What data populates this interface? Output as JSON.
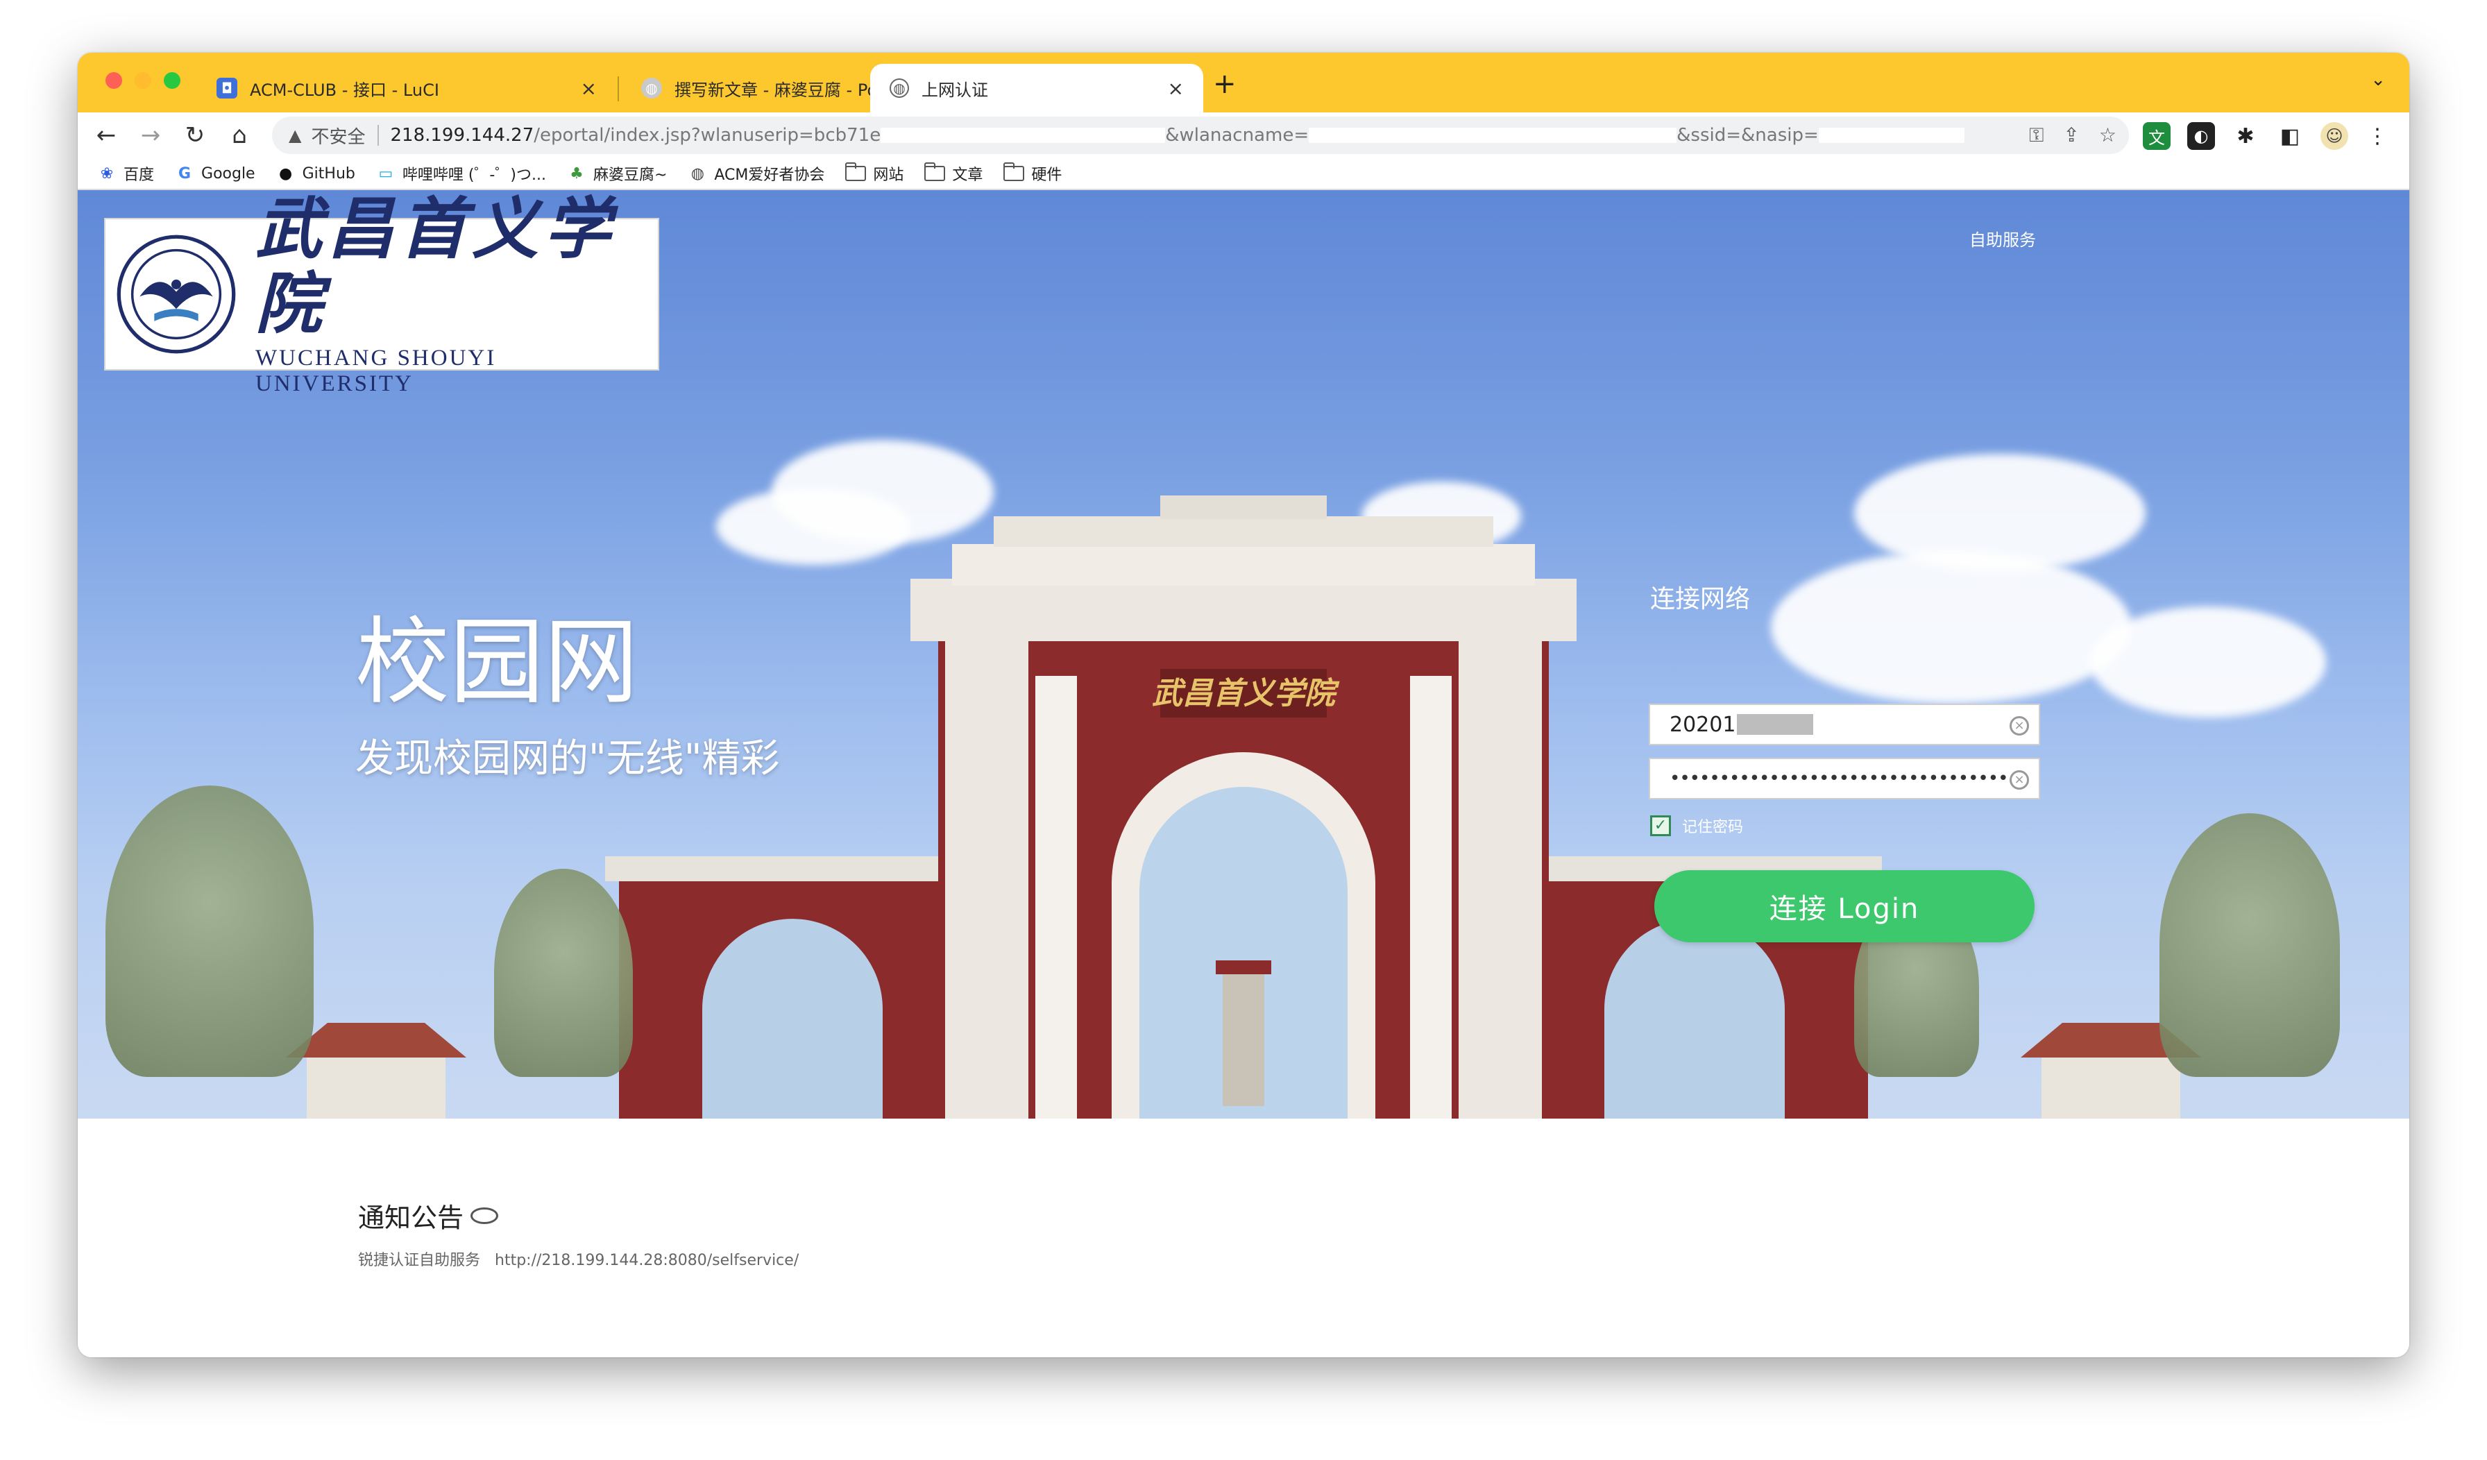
{
  "browser": {
    "tabs": [
      {
        "title": "ACM-CLUB - 接口 - LuCI",
        "favicon": "luci-icon",
        "active": false
      },
      {
        "title": "撰写新文章 - 麻婆豆腐 - Powere",
        "favicon": "globe-icon",
        "active": false
      },
      {
        "title": "上网认证",
        "favicon": "globe-icon",
        "active": true
      }
    ],
    "new_tab": "+",
    "close_glyph": "×",
    "address": {
      "insecure_label": "不安全",
      "url_host": "218.199.144.27",
      "url_path": "/eportal/index.jsp?wlanuserip=bcb71e",
      "url_part2": "&wlanacname=",
      "url_part3": "&ssid=&nasip="
    },
    "bookmarks": [
      {
        "label": "百度",
        "icon": "baidu-icon"
      },
      {
        "label": "Google",
        "icon": "google-icon"
      },
      {
        "label": "GitHub",
        "icon": "github-icon"
      },
      {
        "label": "哔哩哔哩 (゜-゜)つ...",
        "icon": "bilibili-icon"
      },
      {
        "label": "麻婆豆腐~",
        "icon": "leaf-icon"
      },
      {
        "label": "ACM爱好者协会",
        "icon": "globe-icon"
      },
      {
        "label": "网站",
        "icon": "folder-icon"
      },
      {
        "label": "文章",
        "icon": "folder-icon"
      },
      {
        "label": "硬件",
        "icon": "folder-icon"
      }
    ]
  },
  "portal": {
    "logo_cn": "武昌首义学院",
    "logo_en": "WUCHANG SHOUYI UNIVERSITY",
    "self_service": "自助服务",
    "slogan_title": "校园网",
    "slogan_sub": "发现校园网的\"无线\"精彩",
    "form_title": "连接网络",
    "username_value": "20201",
    "password_value": "••••••••••••••••••••••••••••••••••••••••••••••••••",
    "remember_label": "记住密码",
    "remember_checked": true,
    "login_label": "连接 Login",
    "notice_title": "通知公告",
    "notice_item_label": "锐捷认证自助服务",
    "notice_item_url": "http://218.199.144.28:8080/selfservice/"
  },
  "colors": {
    "tab_strip": "#fdc72e",
    "login_button": "#3ec86e",
    "sky_top": "#5f88d7",
    "gate_red": "#8b2b2b",
    "logo_blue": "#1f2d6b"
  }
}
